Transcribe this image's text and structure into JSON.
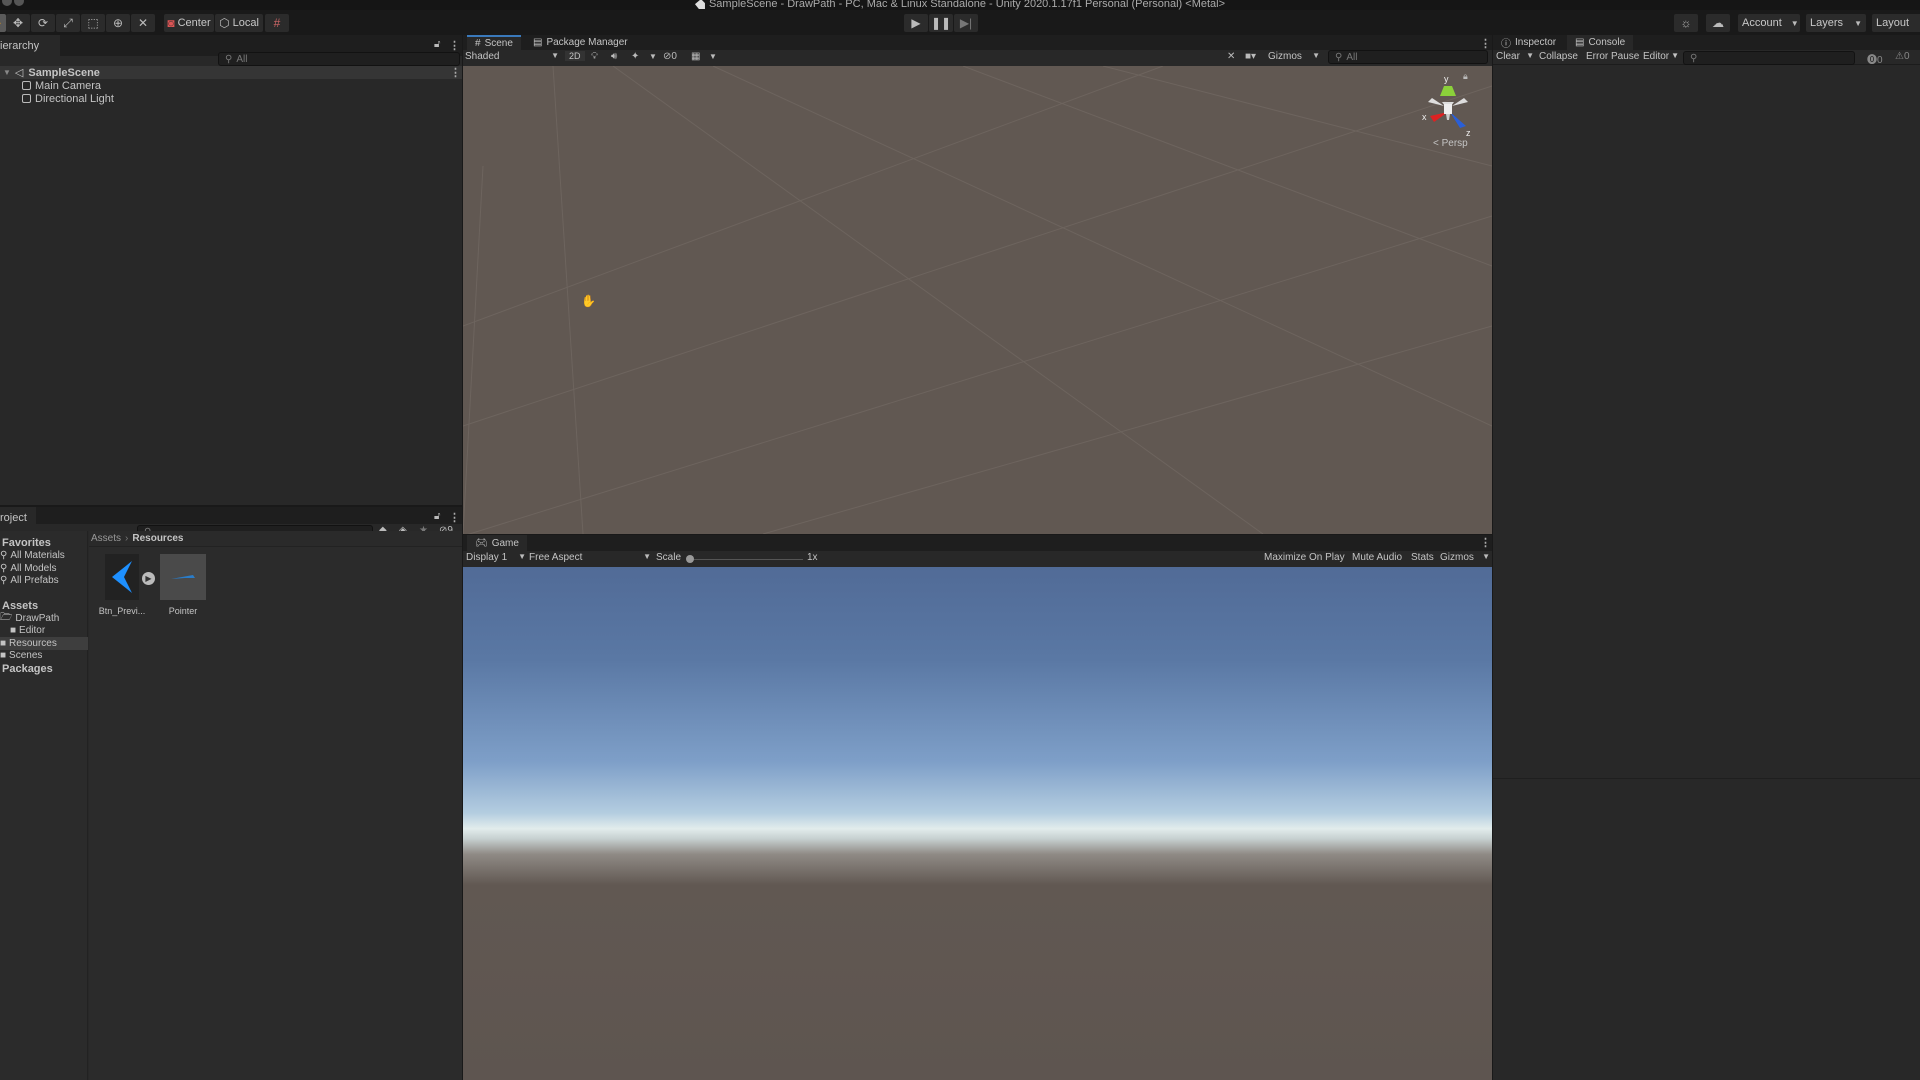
{
  "window": {
    "title": "SampleScene - DrawPath - PC, Mac & Linux Standalone - Unity 2020.1.17f1 Personal (Personal) <Metal>"
  },
  "toolbar": {
    "tools": [
      "hand-tool",
      "move-tool",
      "rotate-tool",
      "scale-tool",
      "rect-tool",
      "transform-tool",
      "custom-tool"
    ],
    "pivot_label": "Center",
    "space_label": "Local",
    "play_controls": [
      "play",
      "pause",
      "step"
    ],
    "account_label": "Account",
    "layers_label": "Layers",
    "layout_label": "Layout"
  },
  "hierarchy": {
    "tab_label": "Hierarchy",
    "tab_label_visible": "ierarchy",
    "search_placeholder": "All",
    "scene_name": "SampleScene",
    "items": [
      {
        "label": "Main Camera"
      },
      {
        "label": "Directional Light"
      }
    ]
  },
  "project": {
    "tab_label_visible": "roject",
    "hidden_count": "9",
    "favorites_header": "Favorites",
    "favorites": [
      {
        "label": "All Materials"
      },
      {
        "label": "All Models"
      },
      {
        "label": "All Prefabs"
      }
    ],
    "assets_header": "Assets",
    "folders": [
      {
        "label": "DrawPath",
        "indent": 0,
        "expanded": true
      },
      {
        "label": "Editor",
        "indent": 1
      },
      {
        "label": "Resources",
        "indent": 0,
        "selected": true
      },
      {
        "label": "Scenes",
        "indent": 0
      }
    ],
    "packages_header": "Packages",
    "breadcrumb": [
      "Assets",
      "Resources"
    ],
    "assets": [
      {
        "label": "Btn_Previ..."
      },
      {
        "label": "Pointer"
      }
    ]
  },
  "scene": {
    "tabs": [
      {
        "label": "Scene",
        "active": true
      },
      {
        "label": "Package Manager",
        "active": false
      }
    ],
    "shading_mode": "Shaded",
    "mode_2d_label": "2D",
    "hidden_objects_count": "0",
    "gizmos_label": "Gizmos",
    "search_placeholder": "All",
    "gizmo_axes": {
      "x": "x",
      "y": "y",
      "z": "z"
    },
    "projection_label": "Persp"
  },
  "game": {
    "tab_label": "Game",
    "display": "Display 1",
    "aspect": "Free Aspect",
    "scale_label": "Scale",
    "scale_value": "1x",
    "maximize_label": "Maximize On Play",
    "mute_label": "Mute Audio",
    "stats_label": "Stats",
    "gizmos_label": "Gizmos"
  },
  "inspector": {
    "tabs": [
      {
        "label": "Inspector",
        "active": false
      },
      {
        "label": "Console",
        "active": true
      }
    ],
    "console": {
      "clear_label": "Clear",
      "collapse_label": "Collapse",
      "error_pause_label": "Error Pause",
      "editor_label": "Editor",
      "error_count": "0",
      "warning_count": "0"
    }
  },
  "colors": {
    "accent": "#3a79bb",
    "scene_bg": "#615852",
    "asset_blue": "#1e90ff"
  }
}
